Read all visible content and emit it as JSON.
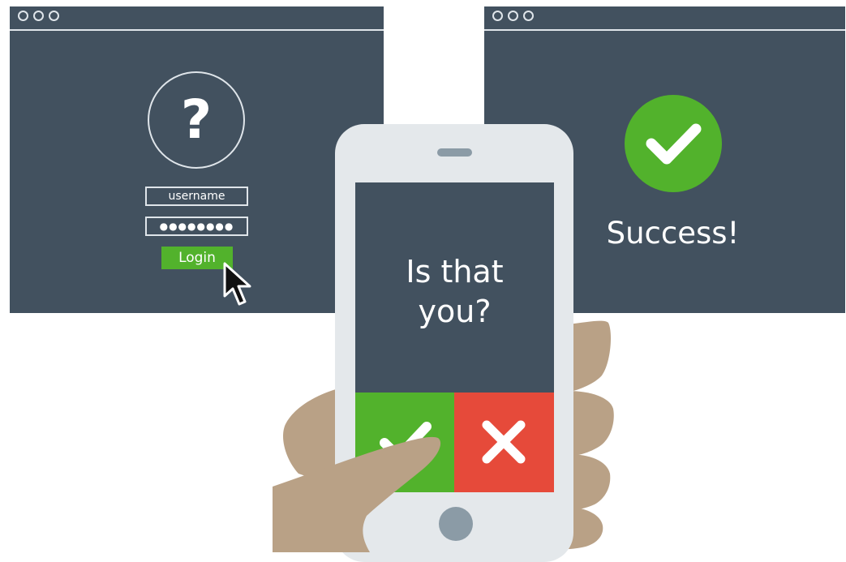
{
  "login_window": {
    "username_label": "username",
    "password_mask": "●●●●●●●●",
    "login_label": "Login",
    "question_glyph": "?"
  },
  "success_window": {
    "success_label": "Success!"
  },
  "phone": {
    "prompt_line1": "Is that",
    "prompt_line2": "you?",
    "approve_icon": "check-icon",
    "deny_icon": "x-icon"
  },
  "colors": {
    "panel": "#42515f",
    "chrome": "#dfe5ea",
    "approve_green": "#52b22c",
    "deny_red": "#e64a3a",
    "skin": "#b9a186"
  }
}
